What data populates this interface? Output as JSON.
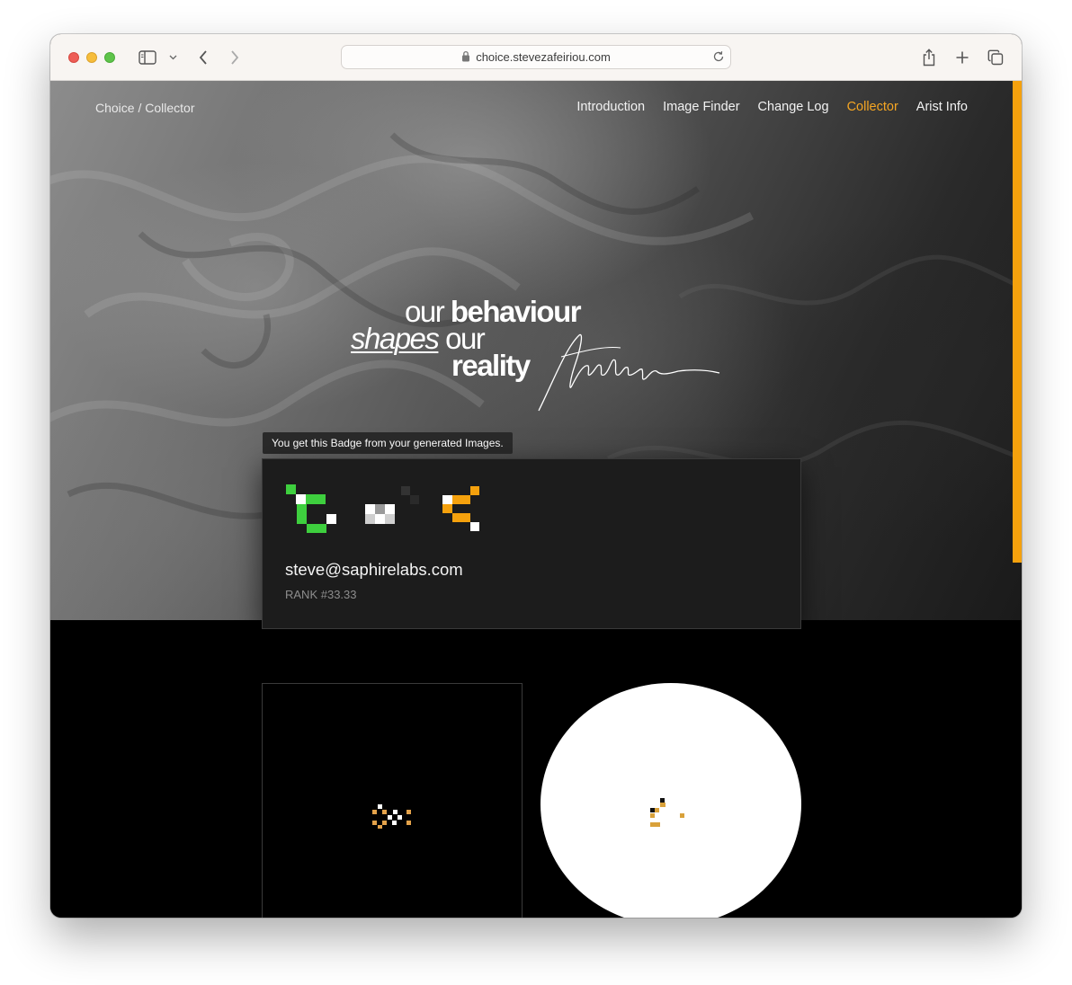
{
  "browser": {
    "url": "choice.stevezafeiriou.com",
    "icons": [
      "sidebar-icon",
      "chevron-down-icon",
      "back-icon",
      "forward-icon",
      "lock-icon",
      "reload-icon",
      "share-icon",
      "new-tab-icon",
      "tabs-overview-icon"
    ]
  },
  "nav": {
    "brand": "Choice / Collector",
    "links": [
      "Introduction",
      "Image Finder",
      "Change Log",
      "Collector",
      "Arist Info"
    ],
    "active": "Collector"
  },
  "hero": {
    "line1_a": "our",
    "line1_b": "behaviour",
    "line2_a": "shapes",
    "line2_b": "our",
    "line3": "reality"
  },
  "profile": {
    "tooltip": "You get this Badge from your generated Images.",
    "email": "steve@saphirelabs.com",
    "rank": "RANK #33.33"
  },
  "tiles": [
    "generated-image-dark",
    "generated-image-light"
  ],
  "colors": {
    "accent": "#f5a623",
    "badge_green": "#3ecf3e",
    "badge_orange": "#f5a10d",
    "card_bg": "#1c1c1c"
  }
}
